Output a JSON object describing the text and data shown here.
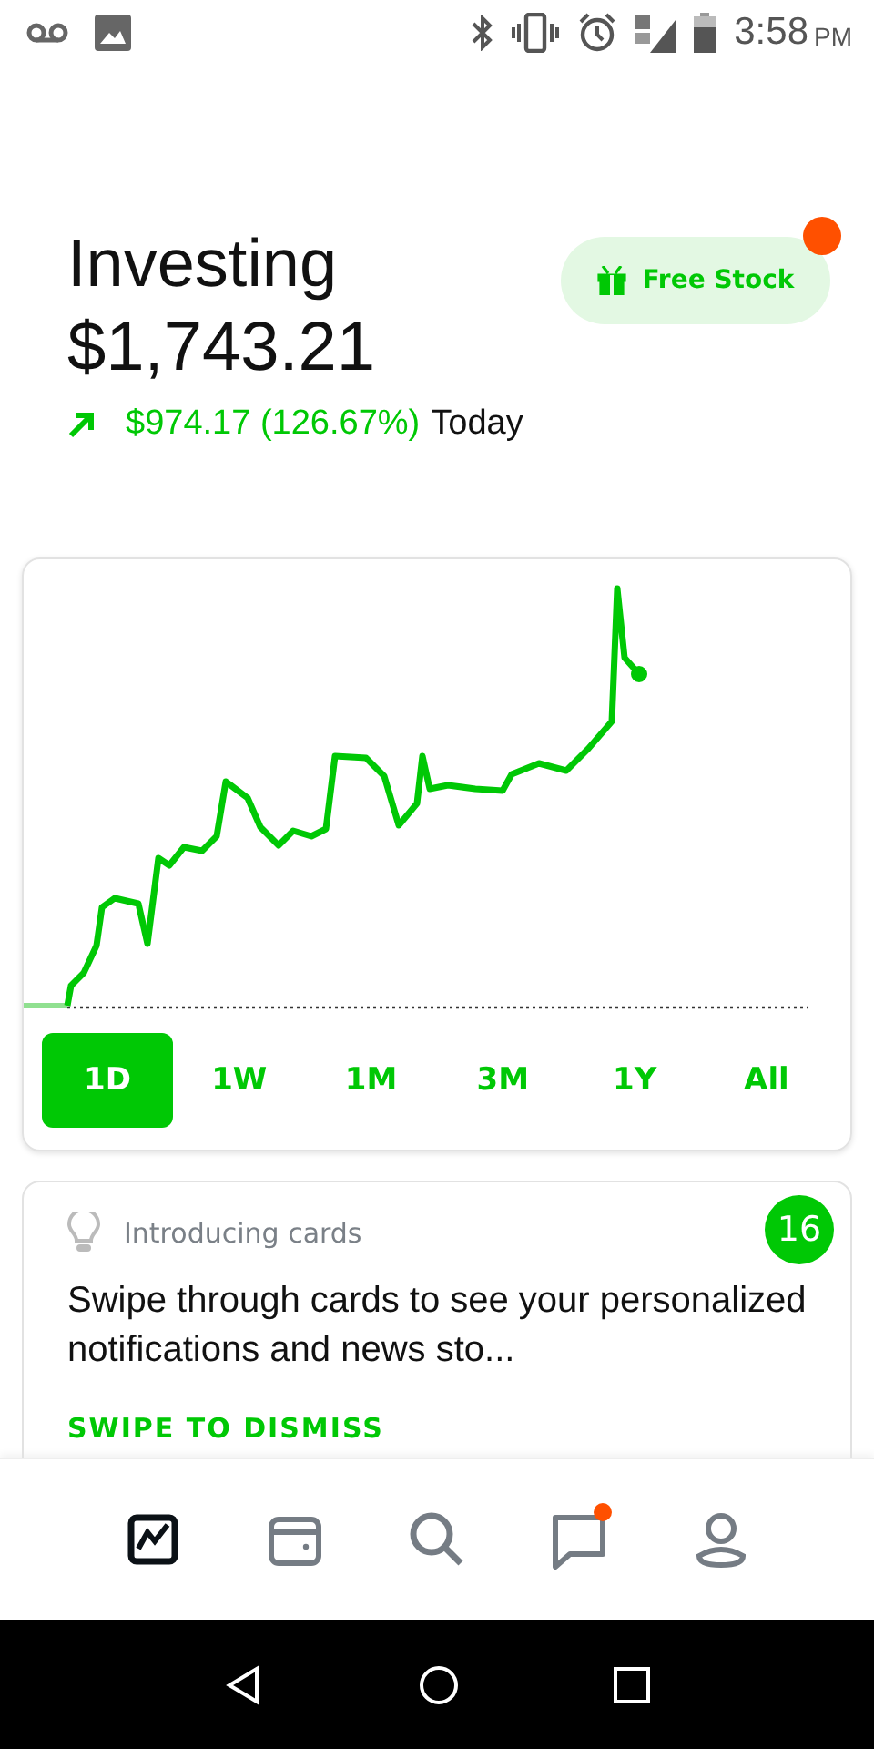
{
  "status_bar": {
    "time": "3:58",
    "period": "PM"
  },
  "header": {
    "title": "Investing",
    "balance": "$1,743.21",
    "change": "$974.17 (126.67%)",
    "change_period": "Today"
  },
  "free_stock": {
    "label": "Free Stock",
    "notification": true
  },
  "ranges": [
    {
      "label": "1D",
      "selected": true
    },
    {
      "label": "1W",
      "selected": false
    },
    {
      "label": "1M",
      "selected": false
    },
    {
      "label": "3M",
      "selected": false
    },
    {
      "label": "1Y",
      "selected": false
    },
    {
      "label": "All",
      "selected": false
    }
  ],
  "card": {
    "eyebrow": "Introducing cards",
    "body": "Swipe through cards to see your personalized notifications and news sto...",
    "action": "SWIPE TO DISMISS",
    "count": "16"
  },
  "nav": [
    {
      "kind": "chart",
      "selected": true,
      "notification": false
    },
    {
      "kind": "wallet",
      "selected": false,
      "notification": false
    },
    {
      "kind": "search",
      "selected": false,
      "notification": false
    },
    {
      "kind": "messages",
      "selected": false,
      "notification": true
    },
    {
      "kind": "account",
      "selected": false,
      "notification": false
    }
  ]
}
